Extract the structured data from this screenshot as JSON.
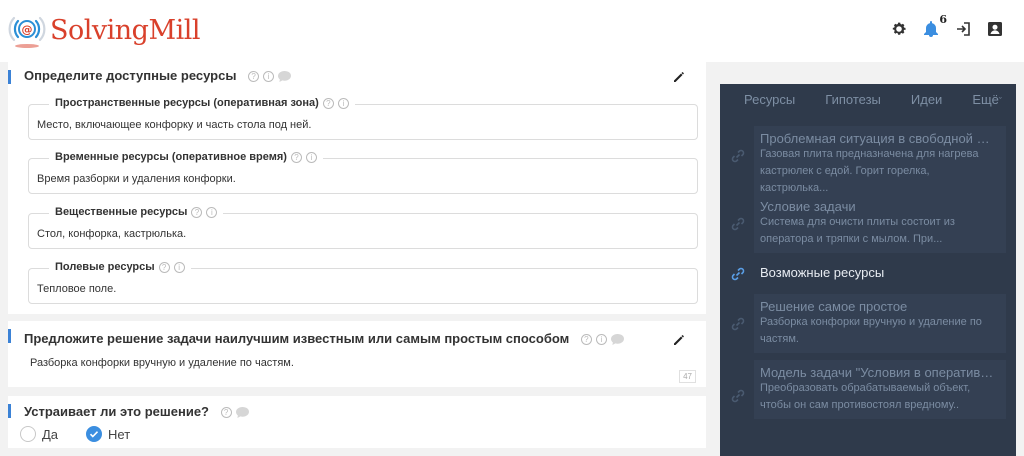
{
  "app": {
    "logo_text": "SolvingMill",
    "notification_count": "6"
  },
  "colors": {
    "accent": "#3b82d6",
    "brand": "#d9402b",
    "panel_bg": "#2f3a4b"
  },
  "resources_card": {
    "title": "Определите доступные ресурсы",
    "groups": [
      {
        "label": "Пространственные ресурсы (оперативная зона)",
        "value": "Место, включающее конфорку и часть стола под ней."
      },
      {
        "label": "Временные ресурсы (оперативное время)",
        "value": "Время разборки и удаления конфорки."
      },
      {
        "label": "Вещественные ресурсы",
        "value": "Стол, конфорка, кастрюлька."
      },
      {
        "label": "Полевые ресурсы",
        "value": "Тепловое поле."
      }
    ]
  },
  "solution_card": {
    "title": "Предложите решение задачи наилучшим известным или самым простым способом",
    "value": "Разборка конфорки вручную и удаление по частям.",
    "counter": "47"
  },
  "satisfy_card": {
    "title": "Устраивает ли это решение?",
    "options": [
      {
        "label": "Да",
        "checked": false
      },
      {
        "label": "Нет",
        "checked": true
      }
    ]
  },
  "right_panel": {
    "tabs": [
      "Ресурсы",
      "Гипотезы",
      "Идеи"
    ],
    "more_tab": "Ещё",
    "items": [
      {
        "title": "Проблемная ситуация в свободной фор...",
        "text": "Газовая плита предназначена для нагрева кастрюлек с едой. Горит горелка, кастрюлька...",
        "active": false
      },
      {
        "title": "Условие задачи",
        "text": "Система для очисти плиты состоит из оператора и тряпки с мылом. При...",
        "active": false
      },
      {
        "title": "Возможные ресурсы",
        "text": "",
        "active": true
      },
      {
        "title": "Решение самое простое",
        "text": "Разборка конфорки вручную и удаление по частям.",
        "active": false
      },
      {
        "title": "Модель задачи \"Условия в оперативной...",
        "text": "Преобразовать обрабатываемый объект, чтобы он сам противостоял вредному..",
        "active": false
      }
    ]
  }
}
